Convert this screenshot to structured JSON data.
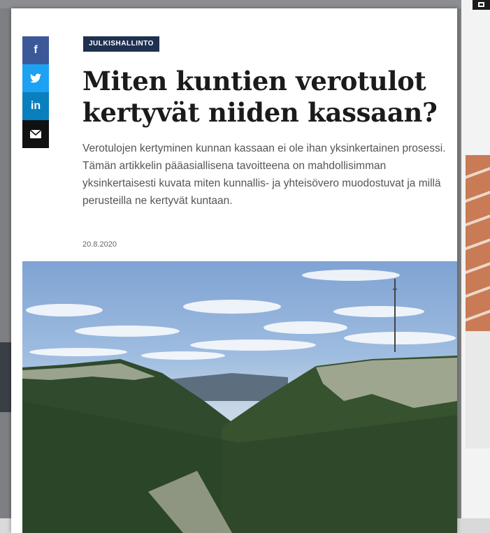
{
  "share": {
    "facebook_icon": "f",
    "twitter_icon": "bird",
    "linkedin_icon": "in",
    "email_icon": "envelope"
  },
  "article": {
    "category": "JULKISHALLINTO",
    "title": "Miten kuntien verotulot kertyvät niiden kassaan?",
    "lead": "Verotulojen kertyminen kunnan kassaan ei ole ihan yksinkertainen prosessi. Tämän artikkelin pääasiallisena tavoitteena on mahdollisimman yksinkertaisesti kuvata miten kunnallis- ja yhteisövero muodostuvat ja millä perusteilla ne kertyvät kuntaan.",
    "date": "20.8.2020"
  },
  "colors": {
    "badge_bg": "#1f3150",
    "facebook": "#3b5998",
    "twitter": "#1da1f2",
    "linkedin": "#0a7fbd",
    "email": "#111111"
  }
}
